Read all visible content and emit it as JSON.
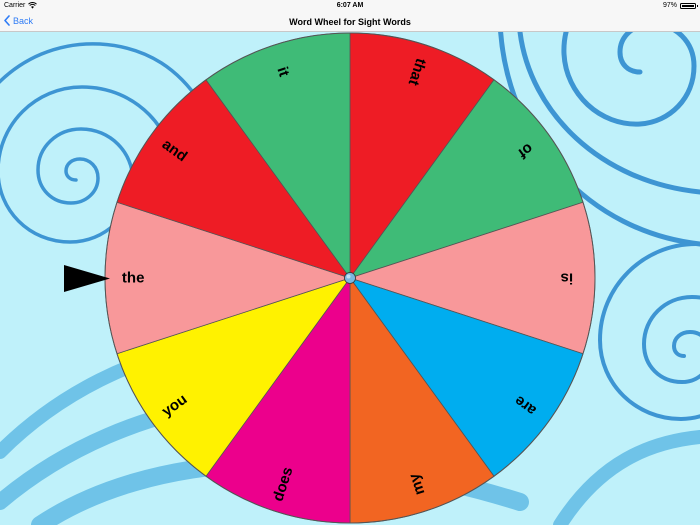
{
  "status_bar": {
    "carrier": "Carrier",
    "time": "6:07 AM",
    "battery_percent": "97%",
    "battery_level": 0.97,
    "wifi_icon": "wifi-icon",
    "battery_icon": "battery-icon"
  },
  "nav": {
    "back_label": "Back",
    "back_icon": "chevron-left-icon",
    "title": "Word Wheel for Sight Words",
    "tint_color": "#2f7cf6"
  },
  "wheel": {
    "words": [
      {
        "word": "that",
        "color": "#ee1c25"
      },
      {
        "word": "of",
        "color": "#3fbb77"
      },
      {
        "word": "is",
        "color": "#f8989a"
      },
      {
        "word": "are",
        "color": "#00adef"
      },
      {
        "word": "my",
        "color": "#f26522"
      },
      {
        "word": "does",
        "color": "#ec008c"
      },
      {
        "word": "you",
        "color": "#fff200"
      },
      {
        "word": "the",
        "color": "#f8989a"
      },
      {
        "word": "and",
        "color": "#ee1c25"
      },
      {
        "word": "it",
        "color": "#3fbb77"
      }
    ],
    "selected_word": "the",
    "hub_color": "#7ab8e0",
    "background_color": "#bff1fa",
    "swirl_color": "#3d95d3"
  }
}
